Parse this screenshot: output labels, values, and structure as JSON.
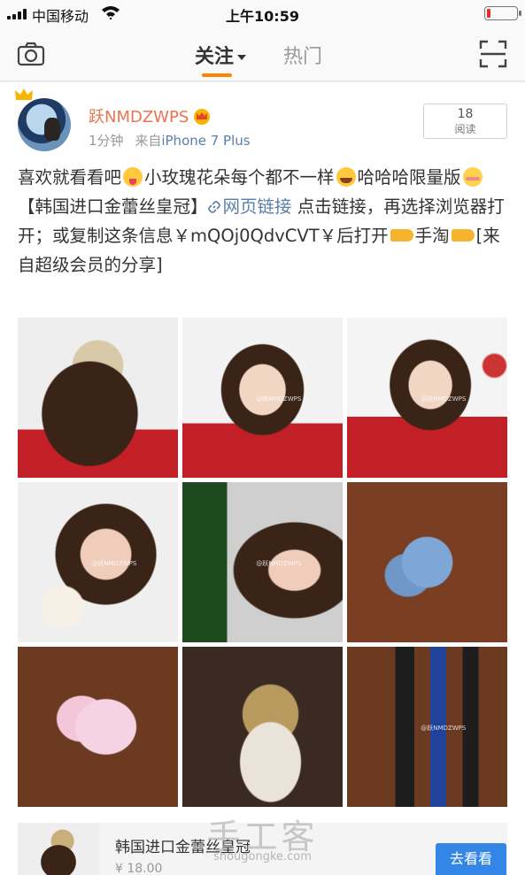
{
  "status_bar": {
    "carrier": "中国移动",
    "time": "上午10:59",
    "battery_level": 0.12
  },
  "nav": {
    "tabs": [
      {
        "label": "关注",
        "active": true
      },
      {
        "label": "热门",
        "active": false
      }
    ],
    "left_icon": "camera-icon",
    "right_icon": "scan-icon",
    "accent_color": "#ff8200"
  },
  "post": {
    "author": "跃NMDZWPS",
    "time_ago": "1分钟",
    "source_prefix": "来自",
    "source_device": "iPhone 7 Plus",
    "read_count": "18",
    "read_label": "阅读",
    "text": {
      "t1": "喜欢就看看吧",
      "t2": "小玫瑰花朵每个都不一样",
      "t3": "哈哈哈限量版",
      "t4": "【韩国进口金蕾丝皇冠】",
      "link": "网页链接",
      "t5": " 点击链接，再选择浏览器打开；或复制这条信息￥mQOj0QdvCVT￥后打开",
      "t6": "手淘",
      "t7": "[来自超级会员的分享]"
    },
    "photo_watermark": "@跃NMDZWPS",
    "photo_count": 9
  },
  "preview": {
    "title": "韩国进口金蕾丝皇冠",
    "price": "¥ 18.00",
    "button": "去看看"
  },
  "watermark": {
    "title": "手工客",
    "url": "shougongke.com"
  },
  "colors": {
    "username": "#eb7350",
    "link": "#5b7fa8",
    "button": "#3385e6"
  }
}
